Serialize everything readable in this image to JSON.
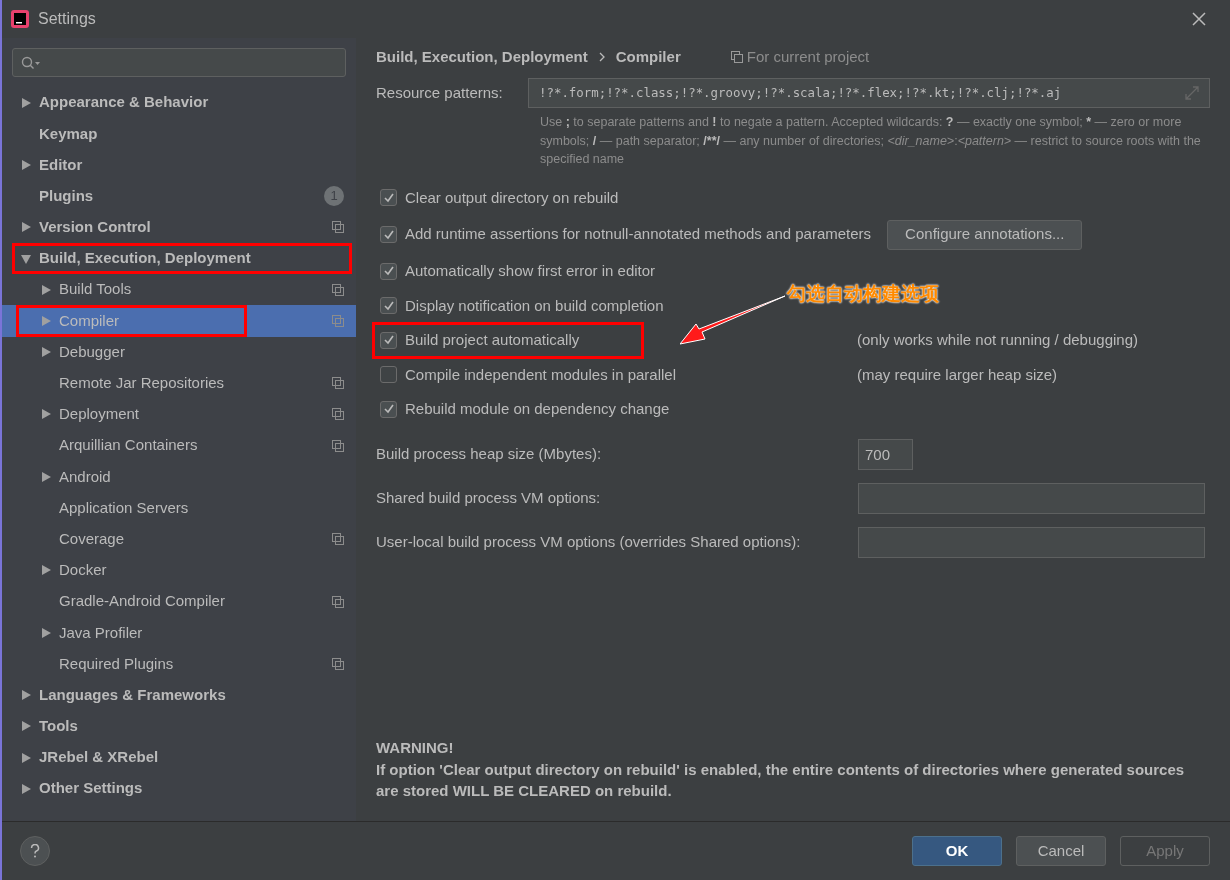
{
  "window": {
    "title": "Settings"
  },
  "sidebar": {
    "items": [
      {
        "label": "Appearance & Behavior",
        "expanded": false,
        "selected": false,
        "project_icon": false
      },
      {
        "label": "Keymap",
        "selected": false,
        "project_icon": false
      },
      {
        "label": "Editor",
        "expanded": false,
        "selected": false,
        "project_icon": false
      },
      {
        "label": "Plugins",
        "selected": false,
        "project_icon": false,
        "badge": "1"
      },
      {
        "label": "Version Control",
        "expanded": false,
        "selected": false,
        "project_icon": true
      },
      {
        "label": "Build, Execution, Deployment",
        "expanded": true,
        "selected": false,
        "project_icon": false,
        "highlighted": true,
        "children": [
          {
            "label": "Build Tools",
            "expanded": false,
            "selected": false,
            "project_icon": true
          },
          {
            "label": "Compiler",
            "expanded": false,
            "selected": true,
            "project_icon": true,
            "highlighted": true
          },
          {
            "label": "Debugger",
            "expanded": false,
            "selected": false,
            "project_icon": false
          },
          {
            "label": "Remote Jar Repositories",
            "selected": false,
            "project_icon": true
          },
          {
            "label": "Deployment",
            "expanded": false,
            "selected": false,
            "project_icon": true
          },
          {
            "label": "Arquillian Containers",
            "selected": false,
            "project_icon": true
          },
          {
            "label": "Android",
            "expanded": false,
            "selected": false,
            "project_icon": false
          },
          {
            "label": "Application Servers",
            "selected": false,
            "project_icon": false
          },
          {
            "label": "Coverage",
            "selected": false,
            "project_icon": true
          },
          {
            "label": "Docker",
            "expanded": false,
            "selected": false,
            "project_icon": false
          },
          {
            "label": "Gradle-Android Compiler",
            "selected": false,
            "project_icon": true
          },
          {
            "label": "Java Profiler",
            "expanded": false,
            "selected": false,
            "project_icon": false
          },
          {
            "label": "Required Plugins",
            "selected": false,
            "project_icon": true
          }
        ]
      },
      {
        "label": "Languages & Frameworks",
        "expanded": false,
        "selected": false,
        "project_icon": false
      },
      {
        "label": "Tools",
        "expanded": false,
        "selected": false,
        "project_icon": false
      },
      {
        "label": "JRebel & XRebel",
        "expanded": false,
        "selected": false,
        "project_icon": false
      },
      {
        "label": "Other Settings",
        "expanded": false,
        "selected": false,
        "project_icon": false
      }
    ]
  },
  "breadcrumb": [
    "Build, Execution, Deployment",
    "Compiler"
  ],
  "scope": "For current project",
  "resource_patterns": {
    "label": "Resource patterns:",
    "value": "!?*.form;!?*.class;!?*.groovy;!?*.scala;!?*.flex;!?*.kt;!?*.clj;!?*.aj",
    "help": [
      {
        "text": "Use ",
        "kind": "plain"
      },
      {
        "text": ";",
        "kind": "bold"
      },
      {
        "text": " to separate patterns and ",
        "kind": "plain"
      },
      {
        "text": "!",
        "kind": "bold"
      },
      {
        "text": " to negate a pattern. Accepted wildcards: ",
        "kind": "plain"
      },
      {
        "text": "?",
        "kind": "bold"
      },
      {
        "text": " — exactly one symbol; ",
        "kind": "plain"
      },
      {
        "text": "*",
        "kind": "bold"
      },
      {
        "text": " — zero or more symbols; ",
        "kind": "plain"
      },
      {
        "text": "/",
        "kind": "bold"
      },
      {
        "text": " — path separator; ",
        "kind": "plain"
      },
      {
        "text": "/**/",
        "kind": "bold"
      },
      {
        "text": " — any number of directories; ",
        "kind": "plain"
      },
      {
        "text": "<dir_name>",
        "kind": "italic"
      },
      {
        "text": ":",
        "kind": "plain"
      },
      {
        "text": "<pattern>",
        "kind": "italic"
      },
      {
        "text": " — restrict to source roots with the specified name",
        "kind": "plain"
      }
    ]
  },
  "options": [
    {
      "label": "Clear output directory on rebuild",
      "checked": true
    },
    {
      "label": "Add runtime assertions for notnull-annotated methods and parameters",
      "checked": true,
      "button": "Configure annotations..."
    },
    {
      "label": "Automatically show first error in editor",
      "checked": true
    },
    {
      "label": "Display notification on build completion",
      "checked": true
    },
    {
      "label": "Build project automatically",
      "checked": true,
      "note": "(only works while not running / debugging)",
      "highlighted": true
    },
    {
      "label": "Compile independent modules in parallel",
      "checked": false,
      "note": "(may require larger heap size)"
    },
    {
      "label": "Rebuild module on dependency change",
      "checked": true
    }
  ],
  "fields": [
    {
      "label": "Build process heap size (Mbytes):",
      "value": "700",
      "kind": "short"
    },
    {
      "label": "Shared build process VM options:",
      "kind": "wide"
    },
    {
      "label": "User-local build process VM options (overrides Shared options):",
      "kind": "wide"
    }
  ],
  "warning": {
    "title": "WARNING!",
    "text": "If option 'Clear output directory on rebuild' is enabled, the entire contents of directories where generated sources are stored WILL BE CLEARED on rebuild."
  },
  "buttons": [
    {
      "label": "OK",
      "kind": "primary"
    },
    {
      "label": "Cancel",
      "kind": "normal"
    },
    {
      "label": "Apply",
      "kind": "disabled"
    }
  ],
  "annotation": {
    "text": "勾选自动构建选项"
  }
}
